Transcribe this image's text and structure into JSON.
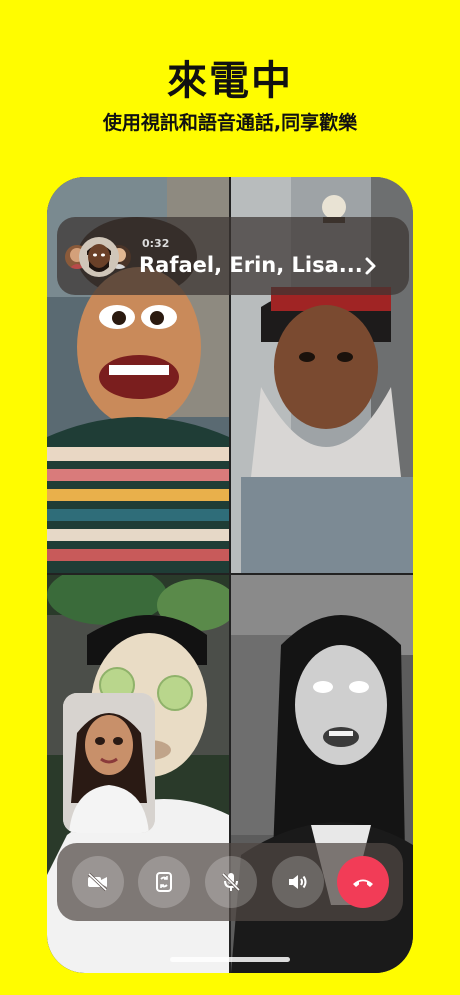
{
  "promo": {
    "headline": "來電中",
    "subheadline": "使用視訊和語音通話,同享歡樂"
  },
  "call": {
    "elapsed": "0:32",
    "participants_title": "Rafael, Erin, Lisa..."
  },
  "controls": {
    "camera_icon": "video-off-icon",
    "flip_icon": "flip-camera-icon",
    "mic_icon": "mic-off-icon",
    "speaker_icon": "speaker-icon",
    "end_icon": "end-call-icon"
  },
  "colors": {
    "background": "#FFFC00",
    "end_call": "#F23C57",
    "overlay": "#3C3432"
  }
}
